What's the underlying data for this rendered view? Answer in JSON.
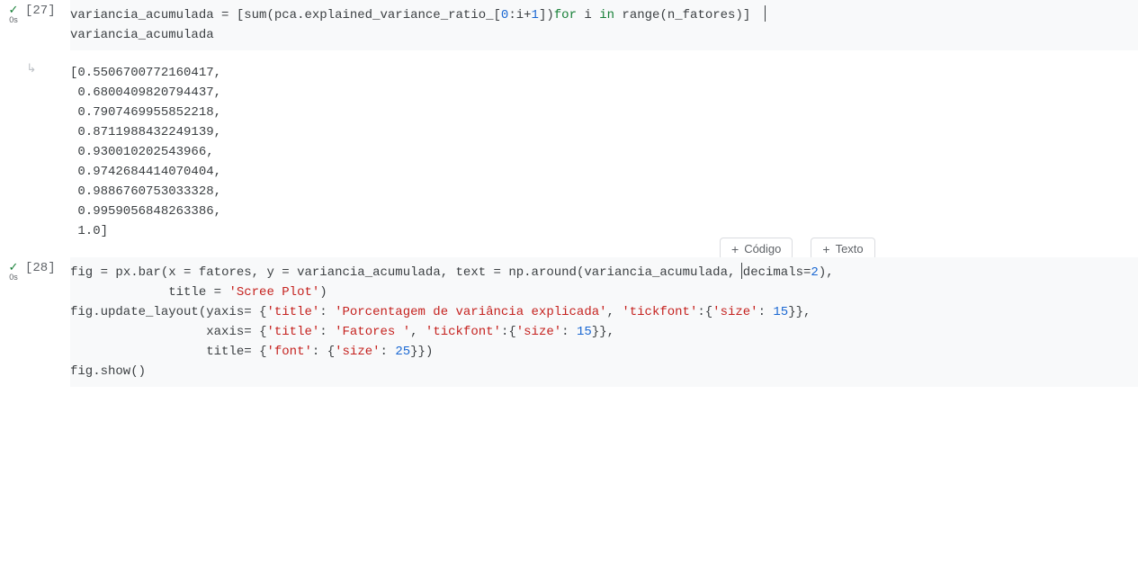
{
  "cell27": {
    "exec_count": "[27]",
    "timing": "0s",
    "code_tokens": {
      "l1a": "variancia_acumulada ",
      "l1eq": "= ",
      "l1b": "[",
      "l1sum": "sum",
      "l1c": "(pca.explained_variance_ratio_[",
      "l1n0": "0",
      "l1d": ":i+",
      "l1n1": "1",
      "l1e": "])",
      "l1for": "for",
      "l1f": " i ",
      "l1in": "in",
      "l1g": " ",
      "l1range": "range",
      "l1h": "(n_fatores)]",
      "l2": "variancia_acumulada"
    },
    "output": "[0.5506700772160417,\n 0.6800409820794437,\n 0.7907469955852218,\n 0.8711988432249139,\n 0.930010202543966,\n 0.9742684414070404,\n 0.9886760753033328,\n 0.9959056848263386,\n 1.0]"
  },
  "insert": {
    "codigo": "Código",
    "texto": "Texto"
  },
  "cell28": {
    "exec_count": "[28]",
    "timing": "0s",
    "code_tokens": {
      "a1": "fig ",
      "a_eq": "= ",
      "a2": "px.bar(x ",
      "a_eq2": "= ",
      "a3": "fatores, y ",
      "a_eq3": "= ",
      "a4": "variancia_acumulada, text ",
      "a_eq4": "= ",
      "a5": "np.around(variancia_acumulada, decimals",
      "a_eq5": "=",
      "a_n2": "2",
      "a6": "),",
      "b_pad": "             ",
      "b1": "title ",
      "b_eq": "= ",
      "b_str": "'Scree Plot'",
      "b2": ")",
      "c1": "fig.update_layout(yaxis",
      "c_eq": "= ",
      "c2": "{",
      "c_k1": "'title'",
      "c3": ": ",
      "c_v1": "'Porcentagem de variância explicada'",
      "c4": ", ",
      "c_k2": "'tickfont'",
      "c5": ":{",
      "c_k3": "'size'",
      "c6": ": ",
      "c_n15": "15",
      "c7": "}},",
      "d_pad": "                  ",
      "d1": "xaxis",
      "d_eq": "= ",
      "d2": "{",
      "d_k1": "'title'",
      "d3": ": ",
      "d_v1": "'Fatores '",
      "d4": ", ",
      "d_k2": "'tickfont'",
      "d5": ":{",
      "d_k3": "'size'",
      "d6": ": ",
      "d_n15": "15",
      "d7": "}},",
      "e_pad": "                  ",
      "e1": "title",
      "e_eq": "= ",
      "e2": "{",
      "e_k1": "'font'",
      "e3": ": {",
      "e_k2": "'size'",
      "e4": ": ",
      "e_n25": "25",
      "e5": "}})",
      "f1": "fig.show()"
    }
  }
}
